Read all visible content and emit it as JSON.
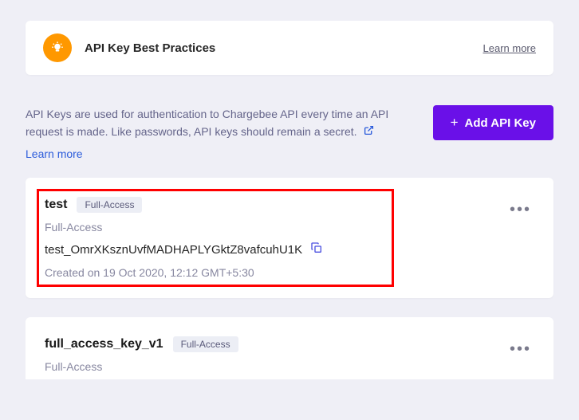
{
  "banner": {
    "title": "API Key Best Practices",
    "learn_more": "Learn more"
  },
  "intro": {
    "text": "API Keys are used for authentication to Chargebee API every time an API request is made. Like passwords, API keys should remain a secret.",
    "learn_more": "Learn more"
  },
  "add_button": {
    "label": "Add API Key"
  },
  "keys": [
    {
      "name": "test",
      "badge": "Full-Access",
      "access": "Full-Access",
      "value": "test_OmrXKsznUvfMADHAPLYGktZ8vafcuhU1K",
      "created": "Created on 19 Oct 2020, 12:12 GMT+5:30"
    },
    {
      "name": "full_access_key_v1",
      "badge": "Full-Access",
      "access": "Full-Access"
    }
  ],
  "colors": {
    "accent": "#6a10e8",
    "highlight": "#ff0000",
    "link": "#2c5cdb"
  }
}
